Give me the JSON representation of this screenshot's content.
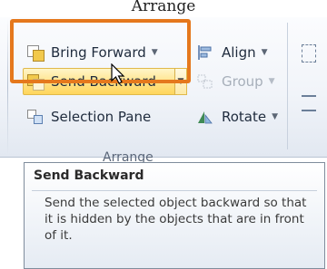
{
  "caption": "Arrange",
  "ribbon": {
    "group_label": "Arrange",
    "buttons": {
      "bring_forward": "Bring Forward",
      "send_backward": "Send Backward",
      "selection_pane": "Selection Pane",
      "align": "Align",
      "group": "Group",
      "rotate": "Rotate"
    },
    "dropdown_glyph": "▼"
  },
  "tooltip": {
    "title": "Send Backward",
    "body": "Send the selected object backward so that it is hidden by the objects that are in front of it."
  },
  "colors": {
    "highlight_border": "#e5781d",
    "hover_fill": "#ffe082"
  },
  "icons": [
    "bring-forward-icon",
    "send-backward-icon",
    "selection-pane-icon",
    "align-icon",
    "group-icon",
    "rotate-icon",
    "pointer-cursor-icon"
  ]
}
